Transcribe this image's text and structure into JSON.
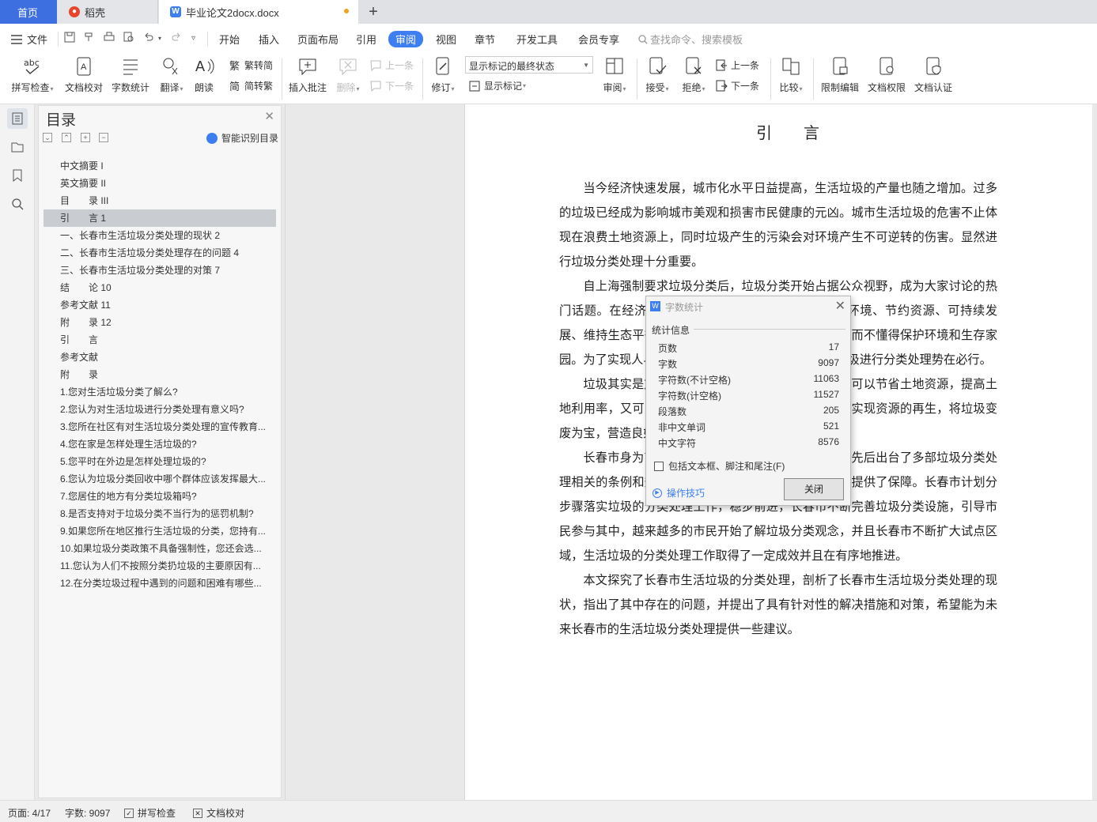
{
  "tabs": {
    "home": "首页",
    "docer": "稻壳",
    "document": "毕业论文2docx.docx",
    "add": "+"
  },
  "menu": {
    "file": "文件",
    "items": [
      "开始",
      "插入",
      "页面布局",
      "引用",
      "审阅",
      "视图",
      "章节",
      "开发工具",
      "会员专享"
    ],
    "active": "审阅",
    "search_placeholder": "查找命令、搜索模板"
  },
  "ribbon": {
    "spell_check": "拼写检查",
    "doc_proofread": "文档校对",
    "word_count": "字数统计",
    "translate": "翻译",
    "read_aloud": "朗读",
    "to_traditional": "繁转简",
    "to_simplified": "简转繁",
    "insert_comment": "插入批注",
    "delete": "删除",
    "prev_comment": "上一条",
    "next_comment": "下一条",
    "revise": "修订",
    "display_state": "显示标记的最终状态",
    "show_markup": "显示标记",
    "review": "审阅",
    "accept": "接受",
    "reject": "拒绝",
    "prev_change": "上一条",
    "next_change": "下一条",
    "compare": "比较",
    "restrict_edit": "限制编辑",
    "doc_permission": "文档权限",
    "doc_certify": "文档认证"
  },
  "toc": {
    "title": "目录",
    "smart": "智能识别目录",
    "selected_index": 3,
    "items": [
      "中文摘要 I",
      "英文摘要 II",
      "目　　录 III",
      "引　　言 1",
      "一、长春市生活垃圾分类处理的现状 2",
      "二、长春市生活垃圾分类处理存在的问题 4",
      "三、长春市生活垃圾分类处理的对策 7",
      "结　　论 10",
      "参考文献 11",
      "附　　录 12",
      "引　　言",
      "参考文献",
      "附　　录",
      "1.您对生活垃圾分类了解么?",
      "2.您认为对生活垃圾进行分类处理有意义吗?",
      "3.您所在社区有对生活垃圾分类处理的宣传教育...",
      "4.您在家是怎样处理生活垃圾的?",
      "5.您平时在外边是怎样处理垃圾的?",
      "6.您认为垃圾分类回收中哪个群体应该发挥最大...",
      "7.您居住的地方有分类垃圾箱吗?",
      "8.是否支持对于垃圾分类不当行为的惩罚机制?",
      "9.如果您所在地区推行生活垃圾的分类，您持有...",
      "10.如果垃圾分类政策不具备强制性，您还会选...",
      "11.您认为人们不按照分类扔垃圾的主要原因有...",
      "12.在分类垃圾过程中遇到的问题和困难有哪些..."
    ]
  },
  "document": {
    "heading": "引言",
    "paragraphs": [
      "当今经济快速发展，城市化水平日益提高，生活垃圾的产量也随之增加。过多的垃圾已经成为影响城市美观和损害市民健康的元凶。城市生活垃圾的危害不止体现在浪费土地资源上，同时垃圾产生的污染会对环境产生不可逆转的伤害。显然进行垃圾分类处理十分重要。",
      "自上海强制要求垃圾分类后，垃圾分类开始占据公众视野，成为大家讨论的热门话题。在经济发展的同时，人们越来越认识到保护环境、节约资源、可持续发展、维持生态平衡的重要性，不能一味地向大自然索取而不懂得保护环境和生存家园。为了实现人与自然和谐发展的目标，所以对生活垃圾进行分类处理势在必行。",
      "垃圾其实是放错位置的资源，对垃圾进行分类处理可以节省土地资源，提高土地利用率，又可以减少环境污染，降低处理成本，同时实现资源的再生，将垃圾变废为宝，营造良好的生活环境。",
      "长春市身为吉林省的省会城市，近年来长春市已经先后出台了多部垃圾分类处理相关的条例和规定，在法律层面上为垃圾的分类处理提供了保障。长春市计划分步骤落实垃圾的分类处理工作，稳步前进，长春市不断完善垃圾分类设施，引导市民参与其中，越来越多的市民开始了解垃圾分类观念，并且长春市不断扩大试点区域，生活垃圾的分类处理工作取得了一定成效并且在有序地推进。",
      "本文探究了长春市生活垃圾的分类处理，剖析了长春市生活垃圾分类处理的现状，指出了其中存在的问题，并提出了具有针对性的解决措施和对策，希望能为未来长春市的生活垃圾分类处理提供一些建议。"
    ]
  },
  "dialog": {
    "title": "字数统计",
    "group": "统计信息",
    "stats": [
      {
        "label": "页数",
        "value": "17"
      },
      {
        "label": "字数",
        "value": "9097"
      },
      {
        "label": "字符数(不计空格)",
        "value": "11063"
      },
      {
        "label": "字符数(计空格)",
        "value": "11527"
      },
      {
        "label": "段落数",
        "value": "205"
      },
      {
        "label": "非中文单词",
        "value": "521"
      },
      {
        "label": "中文字符",
        "value": "8576"
      }
    ],
    "include_label": "包括文本框、脚注和尾注(F)",
    "include_checked": false,
    "tips": "操作技巧",
    "close": "关闭"
  },
  "status": {
    "page": "页面: 4/17",
    "words": "字数: 9097",
    "spell": "拼写检查",
    "proof": "文档校对"
  },
  "colors": {
    "accent": "#3d7ef3",
    "home_tab": "#3d6fe0",
    "modified_dot": "#f2a318",
    "toc_selected": "#c9ccd1"
  }
}
